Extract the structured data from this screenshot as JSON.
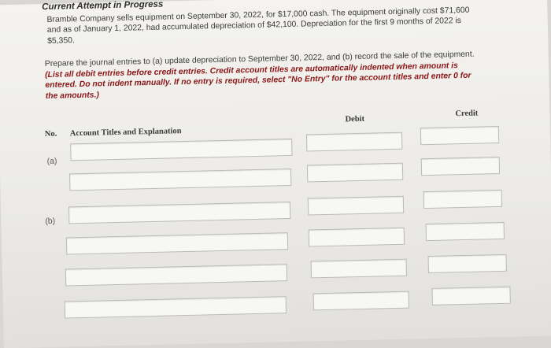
{
  "status": "Current Attempt in Progress",
  "problem": "Bramble Company sells equipment on September 30, 2022, for $17,000 cash. The equipment originally cost $71,600 and as of January 1, 2022, had accumulated depreciation of $42,100. Depreciation for the first 9 months of 2022 is $5,350.",
  "instructions": {
    "lead": "Prepare the journal entries to (a) update depreciation to September 30, 2022, and (b) record the sale of the equipment. ",
    "emphasis": "(List all debit entries before credit entries. Credit account titles are automatically indented when amount is entered. Do not indent manually. If no entry is required, select \"No Entry\" for the account titles and enter 0 for the amounts.)"
  },
  "table": {
    "col_no": "No.",
    "col_account": "Account Titles and Explanation",
    "col_debit": "Debit",
    "col_credit": "Credit"
  },
  "entries": [
    {
      "label": "(a)",
      "rows": [
        {
          "account": "",
          "debit": "",
          "credit": ""
        },
        {
          "account": "",
          "debit": "",
          "credit": ""
        }
      ]
    },
    {
      "label": "(b)",
      "rows": [
        {
          "account": "",
          "debit": "",
          "credit": ""
        },
        {
          "account": "",
          "debit": "",
          "credit": ""
        },
        {
          "account": "",
          "debit": "",
          "credit": ""
        },
        {
          "account": "",
          "debit": "",
          "credit": ""
        }
      ]
    }
  ]
}
